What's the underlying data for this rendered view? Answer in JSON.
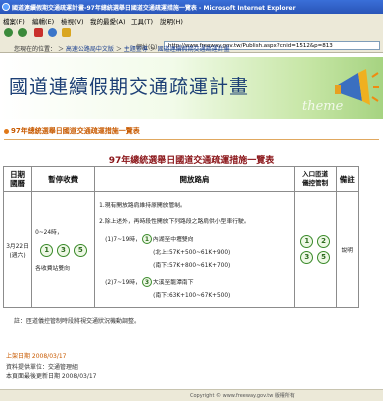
{
  "window": {
    "title": "國道連續假期交通疏運計畫-97年總統選舉日國道交通疏運措施一覽表 - Microsoft Internet Explorer"
  },
  "menu": [
    "檔案(F)",
    "編輯(E)",
    "檢視(V)",
    "我的最愛(A)",
    "工具(T)",
    "說明(H)"
  ],
  "address": {
    "label": "網址(D)",
    "url": "http://www.freeway.gov.tw/Publish.aspx?cnid=1512&p=813"
  },
  "breadcrumb": {
    "prefix": "您現在的位置：",
    "items": [
      "高速公路局中文版",
      "主題宣導",
      "國道連續假期交通疏運計畫"
    ]
  },
  "banner": {
    "title": "國道連續假期交通疏運計畫",
    "watermark": "theme"
  },
  "section": {
    "title": "97年總統選舉日國道交通疏運措施一覽表"
  },
  "table": {
    "title": "97年總統選舉日國道交通疏運措施一覽表",
    "headers": [
      "日期\n國曆",
      "暫停收費",
      "開放路肩",
      "入口匝道\n儀控管制",
      "備註"
    ],
    "row": {
      "date": "3月22日",
      "weekday": "(週六)",
      "toll_time": "0~24時，",
      "toll_circles": [
        "1",
        "3",
        "5"
      ],
      "toll_desc": "各收費站雙向",
      "shoulder_line1": "1.現有開放路肩維持原開放管制。",
      "shoulder_line2": "2.除上述外，再時段性開放下列路段之路肩供小型車行駛。",
      "item1_time": "(1)7~19時，",
      "item1_circle": "1",
      "item1_route": "內湖至中壢雙向",
      "item1_north": "(北上:57K+500~61K+900)",
      "item1_south": "(南下:57K+800~61K+700)",
      "item2_time": "(2)7~19時，",
      "item2_circle": "3",
      "item2_route": "大溪至龍潭南下",
      "item2_south": "(南下:63K+100~67K+500)",
      "ramp_circles": [
        "1",
        "2",
        "3",
        "5"
      ],
      "remark": "說明"
    }
  },
  "note": "註：匝道儀控管制時段將視交通狀況機動調整。",
  "updated": "上架日期 2008/03/17",
  "info": {
    "provider": "資料提供單位：交通管理組",
    "modified": "本頁面最後更新日期 2008/03/17"
  },
  "footer": "Copyright © www.freeway.gov.tw 版權所有"
}
